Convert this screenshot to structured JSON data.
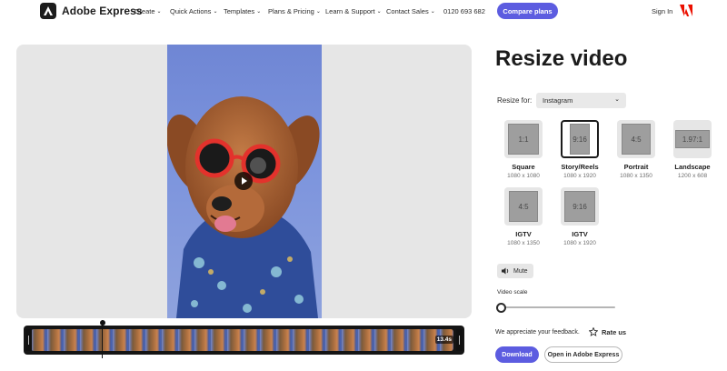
{
  "header": {
    "brand": "Adobe Express",
    "nav": [
      {
        "label": "Create",
        "dropdown": true
      },
      {
        "label": "Quick Actions",
        "dropdown": true
      },
      {
        "label": "Templates",
        "dropdown": true
      },
      {
        "label": "Plans & Pricing",
        "dropdown": true
      },
      {
        "label": "Learn & Support",
        "dropdown": true
      },
      {
        "label": "Contact Sales",
        "dropdown": true
      },
      {
        "label": "0120 693 682",
        "dropdown": false
      }
    ],
    "cta": "Compare plans",
    "sign_in": "Sign In"
  },
  "preview": {
    "timestamp": "13.4s",
    "play_icon": "play-icon"
  },
  "panel": {
    "title": "Resize video",
    "resize_label": "Resize for:",
    "platform": "Instagram",
    "presets": [
      {
        "ratio": "1:1",
        "name": "Square",
        "dims": "1080 x 1080",
        "selected": false
      },
      {
        "ratio": "9:16",
        "name": "Story/Reels",
        "dims": "1080 x 1920",
        "selected": true
      },
      {
        "ratio": "4:5",
        "name": "Portrait",
        "dims": "1080 x 1350",
        "selected": false
      },
      {
        "ratio": "1.97:1",
        "name": "Landscape",
        "dims": "1200 x 608",
        "selected": false
      },
      {
        "ratio": "4:5",
        "name": "IGTV",
        "dims": "1080 x 1350",
        "selected": false
      },
      {
        "ratio": "9:16",
        "name": "IGTV",
        "dims": "1080 x 1920",
        "selected": false
      }
    ],
    "mute_label": "Mute",
    "scale_label": "Video scale",
    "video_scale": 0,
    "feedback": "We appreciate your feedback.",
    "rate_label": "Rate us",
    "download_label": "Download",
    "open_label": "Open in Adobe Express"
  },
  "colors": {
    "accent": "#5c5ce0",
    "video_bg": "#7b93dd"
  }
}
